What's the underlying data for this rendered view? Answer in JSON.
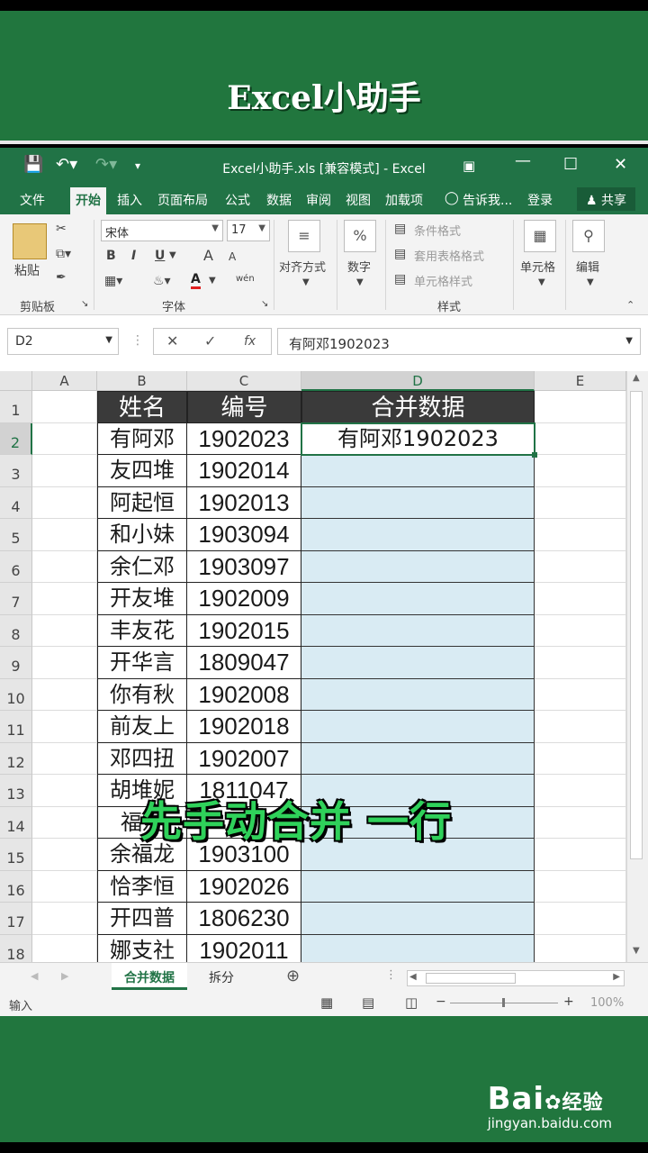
{
  "banner": {
    "title": "Excel小助手"
  },
  "window": {
    "title": "Excel小助手.xls  [兼容模式] - Excel"
  },
  "tabs": [
    "文件",
    "开始",
    "插入",
    "页面布局",
    "公式",
    "数据",
    "审阅",
    "视图",
    "加载项",
    "告诉我...",
    "登录",
    "共享"
  ],
  "ribbon": {
    "paste": "粘贴",
    "clipboard": "剪贴板",
    "font_name": "宋体",
    "font_size": "17",
    "bold": "B",
    "italic": "I",
    "underline": "U",
    "grow": "A",
    "shrink": "A",
    "font_color": "A",
    "wen": "wén",
    "font_group": "字体",
    "align": "对齐方式",
    "number_symbol": "%",
    "number": "数字",
    "cond_format": "条件格式",
    "table_format": "套用表格格式",
    "cell_style": "单元格样式",
    "styles": "样式",
    "cells": "单元格",
    "editing": "编辑"
  },
  "formula_bar": {
    "name_box": "D2",
    "fx": "fx",
    "content": "有阿邓1902023"
  },
  "columns": [
    "A",
    "B",
    "C",
    "D",
    "E"
  ],
  "rows": [
    "1",
    "2",
    "3",
    "4",
    "5",
    "6",
    "7",
    "8",
    "9",
    "10",
    "11",
    "12",
    "13",
    "14",
    "15",
    "16",
    "17",
    "18"
  ],
  "table": {
    "headers": [
      "姓名",
      "编号",
      "合并数据"
    ],
    "names": [
      "有阿邓",
      "友四堆",
      "阿起恒",
      "和小妹",
      "余仁邓",
      "开友堆",
      "丰友花",
      "开华言",
      "你有秋",
      "前友上",
      "邓四扭",
      "胡堆妮",
      "福友",
      "余福龙",
      "恰李恒",
      "开四普",
      "娜支社"
    ],
    "codes": [
      "1902023",
      "1902014",
      "1902013",
      "1903094",
      "1903097",
      "1902009",
      "1902015",
      "1809047",
      "1902008",
      "1902018",
      "1902007",
      "1811047",
      "",
      "1903100",
      "1902026",
      "1806230",
      "1902011"
    ],
    "merged_d2": "有阿邓1902023"
  },
  "overlay_text": "先手动合并 一行",
  "sheets": [
    "合并数据",
    "拆分"
  ],
  "status": {
    "mode": "输入",
    "zoom": "100%"
  },
  "watermark": {
    "logo": "Bai",
    "logo2": "经验",
    "url": "jingyan.baidu.com"
  },
  "colors": {
    "excel_green": "#217346",
    "banner_green": "#21763e",
    "merge_fill": "#d9ebf3",
    "header_fill": "#3a3a3a",
    "overlay": "#2fd15a"
  }
}
